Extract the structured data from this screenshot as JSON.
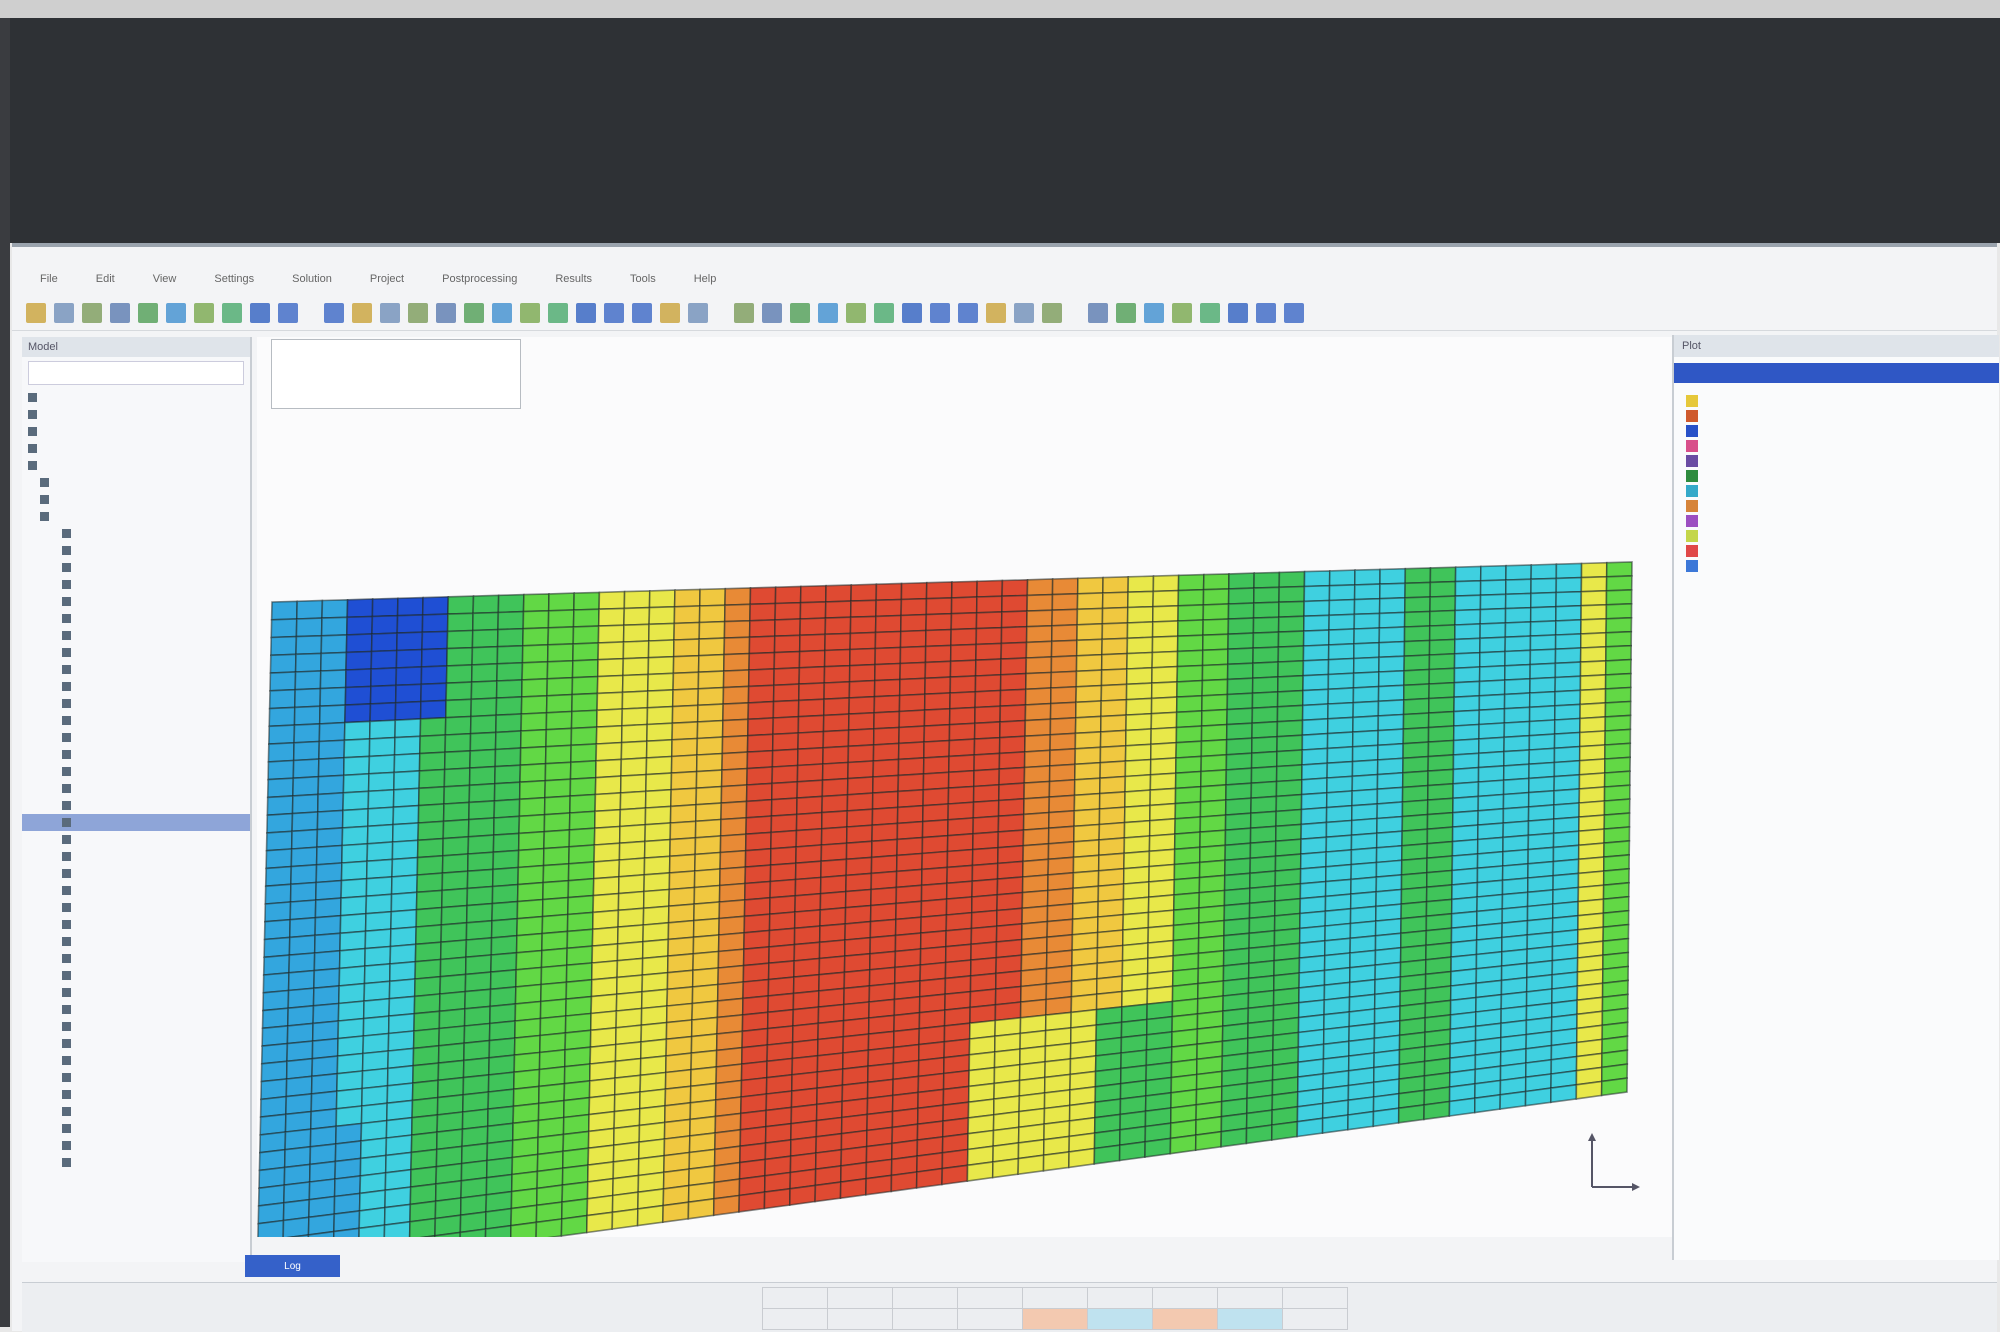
{
  "menu": [
    "File",
    "Edit",
    "View",
    "Settings",
    "Solution",
    "Project",
    "Postprocessing",
    "Results",
    "Tools",
    "Help"
  ],
  "toolbar_icons": [
    "open-icon",
    "save-icon",
    "print-icon",
    "select-icon",
    "zoom-icon",
    "rotate-icon",
    "mesh-icon",
    "refresh-icon",
    "play-icon",
    "step-back-icon",
    "step-forward-icon"
  ],
  "tree": {
    "header": "Model",
    "items": []
  },
  "results_panel": {
    "header": "Plot",
    "tab": "",
    "rows": []
  },
  "legend": {
    "colors": [
      "#e6c83a",
      "#cf5a2d",
      "#2851c8",
      "#d84f8a",
      "#6a4ca3",
      "#2e8b3e",
      "#34a9c9",
      "#d6843a",
      "#9c4fc1",
      "#c4d64a",
      "#e04848",
      "#3c78d8"
    ]
  },
  "heatmap": {
    "palette": [
      "#1f4fd4",
      "#33a6de",
      "#3fd0e0",
      "#40c45a",
      "#62d845",
      "#e8e84a",
      "#f0c840",
      "#e88a36",
      "#df4a32"
    ],
    "column_bands": [
      1,
      1,
      1,
      2,
      2,
      2,
      3,
      3,
      3,
      3,
      4,
      4,
      4,
      5,
      5,
      5,
      6,
      6,
      7,
      8,
      8,
      8,
      8,
      8,
      8,
      8,
      8,
      8,
      8,
      8,
      7,
      7,
      6,
      6,
      5,
      5,
      4,
      4,
      3,
      3,
      3,
      2,
      2,
      2,
      2,
      3,
      3,
      2,
      2,
      2,
      2,
      2,
      5,
      4
    ]
  },
  "log": {
    "tab": "Log",
    "text": ""
  },
  "bottom_table": {
    "headers": []
  }
}
